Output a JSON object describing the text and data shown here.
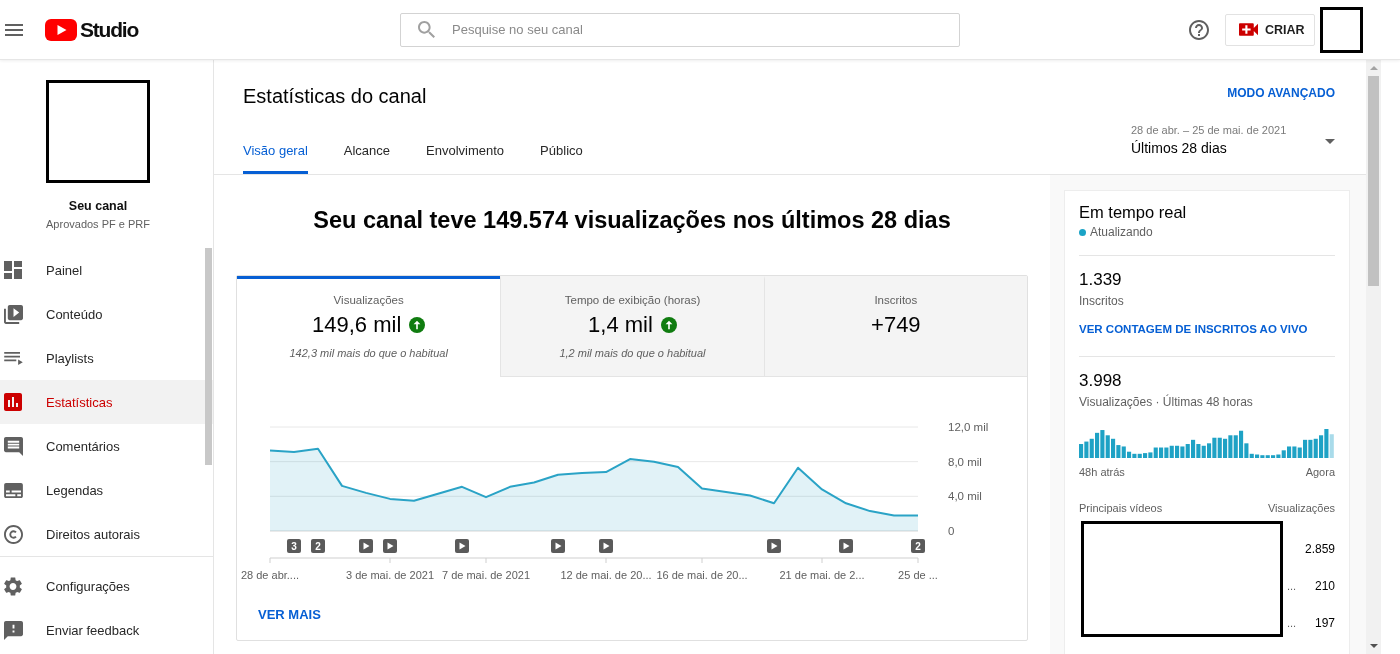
{
  "top_bar": {
    "logo_text": "Studio",
    "search": {
      "placeholder": "Pesquise no seu canal"
    },
    "create_button": "CRIAR"
  },
  "sidebar": {
    "channel": {
      "name": "Seu canal",
      "subtitle": "Aprovados PF e PRF"
    },
    "items": [
      {
        "label": "Painel",
        "selected": false
      },
      {
        "label": "Conteúdo",
        "selected": false
      },
      {
        "label": "Playlists",
        "selected": false
      },
      {
        "label": "Estatísticas",
        "selected": true
      },
      {
        "label": "Comentários",
        "selected": false
      },
      {
        "label": "Legendas",
        "selected": false
      },
      {
        "label": "Direitos autorais",
        "selected": false
      }
    ],
    "footer_items": [
      {
        "label": "Configurações"
      },
      {
        "label": "Enviar feedback"
      }
    ]
  },
  "page": {
    "title": "Estatísticas do canal",
    "advanced_mode": "MODO AVANÇADO",
    "tabs": [
      {
        "label": "Visão geral",
        "selected": true
      },
      {
        "label": "Alcance",
        "selected": false
      },
      {
        "label": "Envolvimento",
        "selected": false
      },
      {
        "label": "Público",
        "selected": false
      }
    ],
    "date_range": {
      "dates": "28 de abr. – 25 de mai. de 2021",
      "label": "Últimos 28 dias"
    }
  },
  "overview": {
    "headline": "Seu canal teve 149.574 visualizações nos últimos 28 dias",
    "metrics": [
      {
        "label": "Visualizações",
        "value": "149,6 mil",
        "trend_up": true,
        "note": "142,3 mil mais do que o habitual",
        "selected": true
      },
      {
        "label": "Tempo de exibição (horas)",
        "value": "1,4 mil",
        "trend_up": true,
        "note": "1,2 mil mais do que o habitual",
        "selected": false
      },
      {
        "label": "Inscritos",
        "value": "+749",
        "trend_up": false,
        "selected": false
      }
    ],
    "chart_data": {
      "type": "area",
      "categories": [
        "28 de abr....",
        null,
        null,
        null,
        null,
        "3 de mai. de 2021",
        null,
        null,
        null,
        "7 de mai. de 2021",
        null,
        null,
        null,
        null,
        "12 de mai. de 20...",
        null,
        null,
        null,
        "16 de mai. de 20...",
        null,
        null,
        null,
        null,
        "21 de mai. de 2...",
        null,
        null,
        null,
        "25 de ..."
      ],
      "series": [
        {
          "color": "#2aa3c6",
          "values": [
            9.3,
            9.1,
            9.5,
            5.2,
            4.4,
            3.7,
            3.5,
            4.3,
            5.1,
            3.9,
            5.1,
            5.6,
            6.5,
            6.7,
            6.8,
            8.3,
            8.0,
            7.4,
            4.9,
            4.5,
            4.1,
            3.2,
            7.3,
            4.8,
            3.2,
            2.3,
            1.8,
            1.8
          ]
        }
      ],
      "ylim": [
        0,
        12
      ],
      "yticks": [
        {
          "value": 0,
          "label": "0"
        },
        {
          "value": 4,
          "label": "4,0 mil"
        },
        {
          "value": 8,
          "label": "8,0 mil"
        },
        {
          "value": 12,
          "label": "12,0 mil"
        }
      ]
    },
    "chart_markers": [
      {
        "kind": "none"
      },
      {
        "kind": "count",
        "text": "3"
      },
      {
        "kind": "count",
        "text": "2"
      },
      {
        "kind": "none"
      },
      {
        "kind": "video"
      },
      {
        "kind": "video"
      },
      {
        "kind": "none"
      },
      {
        "kind": "none"
      },
      {
        "kind": "video"
      },
      {
        "kind": "none"
      },
      {
        "kind": "none"
      },
      {
        "kind": "none"
      },
      {
        "kind": "video"
      },
      {
        "kind": "none"
      },
      {
        "kind": "video"
      },
      {
        "kind": "none"
      },
      {
        "kind": "none"
      },
      {
        "kind": "none"
      },
      {
        "kind": "none"
      },
      {
        "kind": "none"
      },
      {
        "kind": "none"
      },
      {
        "kind": "video"
      },
      {
        "kind": "none"
      },
      {
        "kind": "none"
      },
      {
        "kind": "video"
      },
      {
        "kind": "none"
      },
      {
        "kind": "none"
      },
      {
        "kind": "count",
        "text": "2"
      }
    ],
    "see_more": "VER MAIS"
  },
  "realtime": {
    "title": "Em tempo real",
    "status": "Atualizando",
    "subscribers": {
      "value": "1.339",
      "label": "Inscritos",
      "link": "VER CONTAGEM DE INSCRITOS AO VIVO"
    },
    "views": {
      "value": "3.998",
      "label": "Visualizações · Últimas 48 horas",
      "start": "48h atrás",
      "end": "Agora"
    },
    "top_videos": {
      "heading": "Principais vídeos",
      "views_heading": "Visualizações",
      "rows": [
        {
          "views": "2.859"
        },
        {
          "title": "...",
          "views": "210"
        },
        {
          "title": "...",
          "views": "197"
        }
      ]
    }
  }
}
